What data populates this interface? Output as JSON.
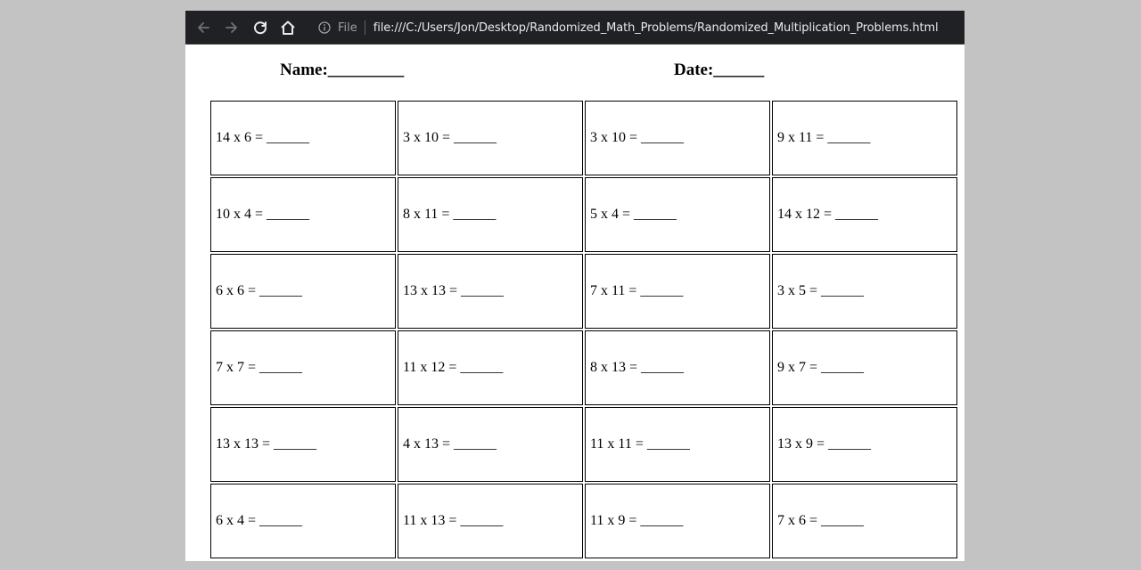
{
  "browser": {
    "scheme_label": "File",
    "url": "file:///C:/Users/Jon/Desktop/Randomized_Math_Problems/Randomized_Multiplication_Problems.html",
    "icons": [
      "back-arrow-icon",
      "forward-arrow-icon",
      "reload-icon",
      "home-icon",
      "info-icon"
    ]
  },
  "worksheet": {
    "name_label": "Name:_________",
    "date_label": "Date:______",
    "rows": [
      [
        "14 x 6 = ______",
        "3 x 10 = ______",
        "3 x 10 = ______",
        "9 x 11 = ______"
      ],
      [
        "10 x 4 = ______",
        "8 x 11 = ______",
        "5 x 4 = ______",
        "14 x 12 = ______"
      ],
      [
        "6 x 6 = ______",
        "13 x 13 = ______",
        "7 x 11 = ______",
        "3 x 5 = ______"
      ],
      [
        "7 x 7 = ______",
        "11 x 12 = ______",
        "8 x 13 = ______",
        "9 x 7 = ______"
      ],
      [
        "13 x 13 = ______",
        "4 x 13 = ______",
        "11 x 11 = ______",
        "13 x 9 = ______"
      ],
      [
        "6 x 4 = ______",
        "11 x 13 = ______",
        "11 x 9 = ______",
        "7 x 6 = ______"
      ]
    ]
  }
}
